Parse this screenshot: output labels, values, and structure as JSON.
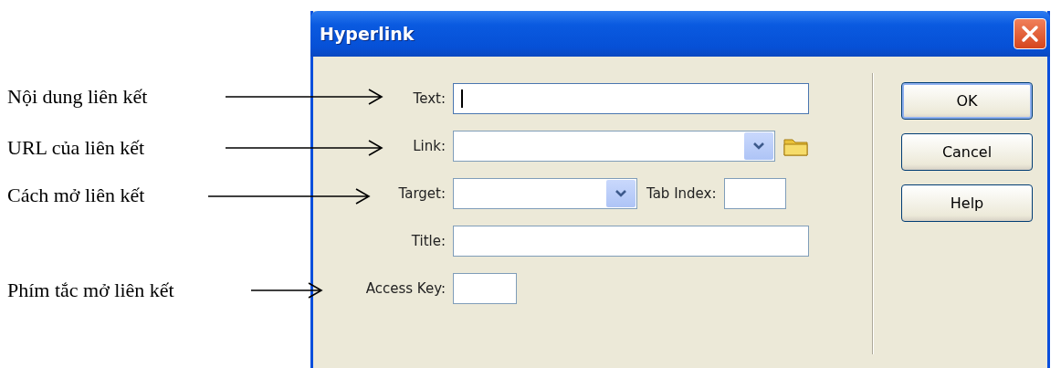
{
  "annotations": [
    {
      "text": "Nội dung liên kết"
    },
    {
      "text": "URL của liên kết"
    },
    {
      "text": "Cách mở liên kết"
    },
    {
      "text": "Phím tắc mở liên kết"
    }
  ],
  "dialog": {
    "title": "Hyperlink",
    "fields": [
      {
        "kind": "text",
        "label": "Text:",
        "focused": true
      },
      {
        "kind": "browse-combo",
        "label": "Link:",
        "focused": false
      },
      {
        "kind": "combo",
        "label": "Target:",
        "focused": false,
        "extra": {
          "label": "Tab Index:"
        }
      },
      {
        "kind": "text",
        "label": "Title:",
        "focused": false
      },
      {
        "kind": "short",
        "label": "Access Key:",
        "focused": false
      }
    ],
    "buttons": [
      {
        "label": "OK",
        "default": true
      },
      {
        "label": "Cancel",
        "default": false
      },
      {
        "label": "Help",
        "default": false
      }
    ]
  }
}
